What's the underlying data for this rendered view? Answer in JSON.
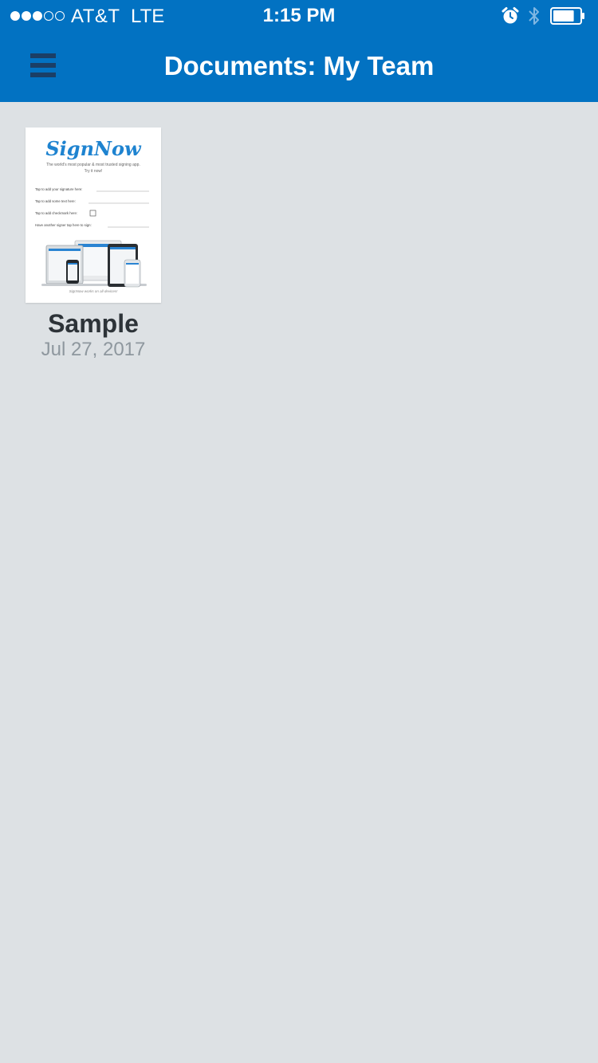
{
  "status_bar": {
    "carrier": "AT&T",
    "network": "LTE",
    "time": "1:15 PM",
    "signal_bars_filled": 3,
    "signal_bars_total": 5,
    "battery_level": 0.8,
    "icons": [
      "alarm-icon",
      "bluetooth-icon",
      "battery-icon"
    ]
  },
  "nav": {
    "title": "Documents: My Team",
    "menu_icon": "hamburger-menu-icon"
  },
  "colors": {
    "header_bg": "#0272c2",
    "page_bg": "#dde1e4",
    "menu_icon": "#1b3f66",
    "brand_blue": "#1e83d0"
  },
  "documents": [
    {
      "name": "Sample",
      "date": "Jul 27, 2017",
      "thumbnail": {
        "logo": "SignNow",
        "tagline": "The world's most popular & most trusted signing app.",
        "tagline2": "Try it now!",
        "lines": [
          "Tap to add your signature here:",
          "Tap to add some text here:",
          "Tap to add checkmark here:",
          "Have another signer tap here to sign:"
        ],
        "footer": "SignNow works on all devices!"
      }
    }
  ]
}
